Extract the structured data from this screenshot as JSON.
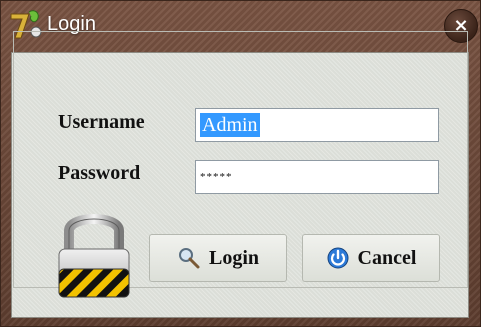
{
  "window": {
    "title": "Login",
    "close_symbol": "×"
  },
  "form": {
    "username_label": "Username",
    "username_value": "Admin",
    "password_label": "Password",
    "password_value": "*****"
  },
  "buttons": {
    "login_label": "Login",
    "cancel_label": "Cancel"
  },
  "icons": {
    "app_logo": "app-logo-icon",
    "close": "close-icon",
    "login": "magnifier-key-icon",
    "cancel": "power-icon",
    "lock": "padlock-icon"
  },
  "colors": {
    "selection": "#3399ff",
    "titlebar": "#6a4a38",
    "panel": "#dfe2dc"
  }
}
